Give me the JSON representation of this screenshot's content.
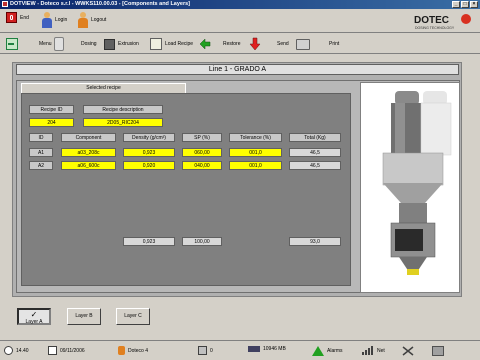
{
  "window": {
    "title": "DOTVIEW - Doteco s.r.l - WWKS110.00.03 - [Components and Layers]"
  },
  "top_toolbar": {
    "end": "End",
    "login": "Login",
    "logout": "Logout"
  },
  "logo": {
    "text": "DOTECO",
    "sub": "DOSING TECHNOLOGY"
  },
  "main_toolbar": {
    "menu": "Menu",
    "dosing": "Dosing",
    "extrusion": "Extrusion",
    "load_recipe": "Load Recipe",
    "restore": "Restore",
    "send": "Send",
    "print": "Print"
  },
  "panel": {
    "title": "Line 1 - GRADO A",
    "tab": "Selected recipe"
  },
  "recipe": {
    "id_label": "Recipe ID",
    "desc_label": "Recipe description",
    "id_value": "204",
    "desc_value": "2D05_RIC204"
  },
  "table": {
    "headers": [
      "ID",
      "Component",
      "Density (g/cm³)",
      "SP (%)",
      "Tolerance (%)",
      "Total (Kg)"
    ],
    "rows": [
      [
        "A1",
        "a03_208c",
        "0,923",
        "060,00",
        "001,0",
        "46,5"
      ],
      [
        "A2",
        "a06_600c",
        "0,920",
        "040,00",
        "001,0",
        "46,5"
      ]
    ],
    "totals": {
      "density": "0,923",
      "sp": "100,00",
      "total": "93,0"
    }
  },
  "layers": {
    "a": "Layer A",
    "b": "Layer B",
    "c": "Layer C"
  },
  "status": {
    "time": "14.40",
    "date": "09/11/2006",
    "user": "Doteco 4",
    "sys": "0",
    "memory": "10946 MB",
    "alarms": "Alarms",
    "net": "Net"
  },
  "colors": {
    "highlight": "#ffff00",
    "accent": "#0a246a"
  }
}
